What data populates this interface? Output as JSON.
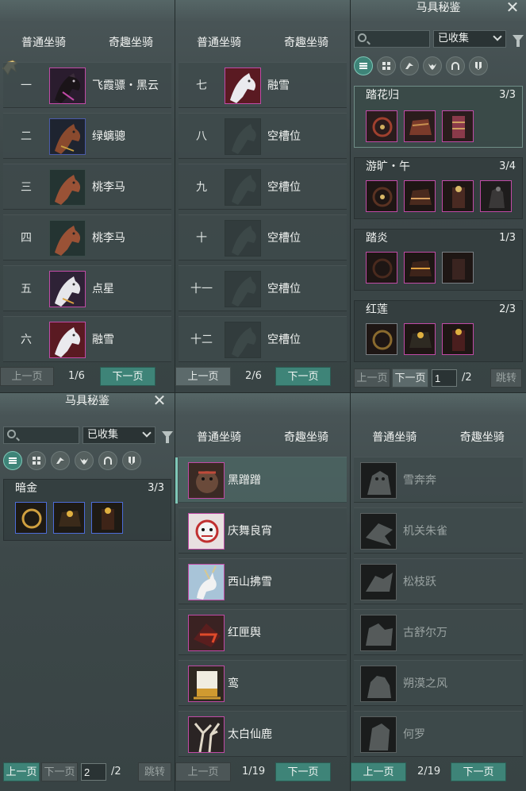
{
  "panel_a": {
    "tabs": [
      "普通坐骑",
      "奇趣坐骑"
    ],
    "slots": [
      {
        "num": "一",
        "name": "飞霞骠・黑云",
        "frame": "purple"
      },
      {
        "num": "二",
        "name": "绿螭骢",
        "frame": "blue"
      },
      {
        "num": "三",
        "name": "桃李马",
        "frame": "default"
      },
      {
        "num": "四",
        "name": "桃李马",
        "frame": "default"
      },
      {
        "num": "五",
        "name": "点星",
        "frame": "purple"
      },
      {
        "num": "六",
        "name": "融雪",
        "frame": "purple"
      }
    ],
    "prev_label": "上一页",
    "next_label": "下一页",
    "page_text": "1/6"
  },
  "panel_b": {
    "tabs": [
      "普通坐骑",
      "奇趣坐骑"
    ],
    "slots": [
      {
        "num": "七",
        "name": "融雪",
        "frame": "purple"
      },
      {
        "num": "八",
        "name": "空槽位",
        "frame": "empty"
      },
      {
        "num": "九",
        "name": "空槽位",
        "frame": "empty"
      },
      {
        "num": "十",
        "name": "空槽位",
        "frame": "empty"
      },
      {
        "num": "十一",
        "name": "空槽位",
        "frame": "empty"
      },
      {
        "num": "十二",
        "name": "空槽位",
        "frame": "empty"
      }
    ],
    "prev_label": "上一页",
    "next_label": "下一页",
    "page_text": "2/6"
  },
  "panel_c": {
    "title": "马具秘鉴",
    "filter_value": "已收集",
    "category_icons": [
      "list-icon",
      "grid-icon",
      "saddle-icon",
      "wings-icon",
      "horseshoe-icon",
      "shield-icon"
    ],
    "sets": [
      {
        "name": "踏花归",
        "count": "3/3",
        "pieces": 3
      },
      {
        "name": "游旷・午",
        "count": "3/4",
        "pieces": 4
      },
      {
        "name": "踏炎",
        "count": "1/3",
        "pieces": 3
      },
      {
        "name": "红莲",
        "count": "2/3",
        "pieces": 3
      }
    ],
    "prev_label": "上一页",
    "next_label": "下一页",
    "page_input": "1",
    "page_total": "/2",
    "jump_label": "跳转"
  },
  "panel_d": {
    "title": "马具秘鉴",
    "filter_value": "已收集",
    "sets": [
      {
        "name": "暗金",
        "count": "3/3",
        "pieces": 3
      }
    ],
    "prev_label": "上一页",
    "next_label": "下一页",
    "page_input": "2",
    "page_total": "/2",
    "jump_label": "跳转"
  },
  "panel_e": {
    "tabs": [
      "普通坐骑",
      "奇趣坐骑"
    ],
    "items": [
      "黑蹭蹭",
      "庆舞良宵",
      "西山拂雪",
      "红匣舆",
      "鸾",
      "太白仙鹿"
    ],
    "prev_label": "上一页",
    "next_label": "下一页",
    "page_text": "1/19"
  },
  "panel_f": {
    "tabs": [
      "普通坐骑",
      "奇趣坐骑"
    ],
    "items": [
      "雪奔奔",
      "机关朱雀",
      "松枝跃",
      "古舒尔万",
      "朔漠之风",
      "何罗"
    ],
    "prev_label": "上一页",
    "next_label": "下一页",
    "page_text": "2/19"
  },
  "colors": {
    "accent": "#3e8478",
    "frame_purple": "#c04aa6",
    "frame_blue": "#4c6cd8"
  }
}
